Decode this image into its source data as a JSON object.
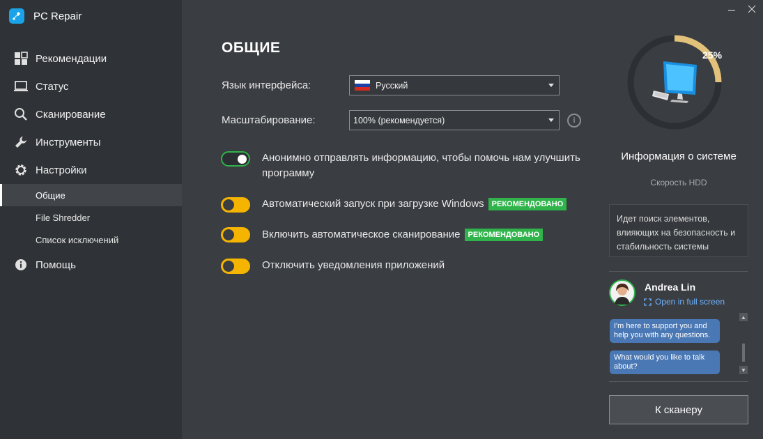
{
  "app": {
    "name": "PC Repair",
    "accent": "#1aa3e8"
  },
  "sidebar": {
    "items": [
      {
        "label": "Рекомендации",
        "icon": "grid-icon"
      },
      {
        "label": "Статус",
        "icon": "monitor-icon"
      },
      {
        "label": "Сканирование",
        "icon": "search-icon"
      },
      {
        "label": "Инструменты",
        "icon": "wrench-icon"
      },
      {
        "label": "Настройки",
        "icon": "gear-icon"
      }
    ],
    "subitems": [
      {
        "label": "Общие",
        "active": true
      },
      {
        "label": "File Shredder",
        "active": false
      },
      {
        "label": "Список исключений",
        "active": false
      }
    ],
    "help": {
      "label": "Помощь",
      "icon": "info-icon"
    }
  },
  "main": {
    "title": "ОБЩИЕ",
    "language": {
      "label": "Язык интерфейса:",
      "value": "Русский",
      "flag": "russia-flag-icon"
    },
    "scaling": {
      "label": "Масштабирование:",
      "value": "100% (рекомендуется)"
    },
    "options": [
      {
        "text": "Анонимно отправлять информацию, чтобы помочь нам улучшить программу",
        "state": "on",
        "badge": ""
      },
      {
        "text": "Автоматический запуск при загрузке Windows",
        "state": "off",
        "badge": "РЕКОМЕНДОВАНО"
      },
      {
        "text": "Включить автоматическое сканирование",
        "state": "off",
        "badge": "РЕКОМЕНДОВАНО"
      },
      {
        "text": "Отключить уведомления приложений",
        "state": "off",
        "badge": ""
      }
    ],
    "colors": {
      "toggle_on": "#2fb34a",
      "toggle_off": "#f5b400",
      "badge": "#2fb34a"
    }
  },
  "panel": {
    "progress_label": "25%",
    "progress": 0.25,
    "system_title": "Информация о системе",
    "system_sub": "Скорость HDD",
    "search_text": "Идет поиск элементов, влияющих на безопасность и стабильность системы",
    "agent": {
      "name": "Andrea Lin",
      "fullscreen": "Open in full screen"
    },
    "messages": [
      "I'm here to support you and help you with any questions.",
      "What would you like to talk about?"
    ],
    "scanner_button": "К сканеру"
  }
}
